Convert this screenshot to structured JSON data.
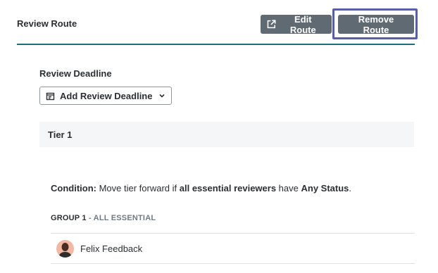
{
  "header": {
    "title": "Review Route",
    "edit_label": "Edit Route",
    "remove_label": "Remove Route"
  },
  "deadline": {
    "label": "Review Deadline",
    "add_label": "Add Review Deadline"
  },
  "tier": {
    "label": "Tier 1",
    "condition": {
      "prefix": "Condition:",
      "text1": " Move tier forward if ",
      "bold1": "all essential reviewers",
      "text2": " have ",
      "bold2": "Any Status",
      "suffix": "."
    },
    "group": {
      "name": "GROUP 1",
      "qualifier": " - ALL ESSENTIAL"
    },
    "reviewers": [
      {
        "name": "Felix Feedback"
      }
    ]
  },
  "colors": {
    "header_rule": "#1d6f7a",
    "button_bg": "#5f6a73",
    "focus_ring": "#5b5ea6"
  }
}
